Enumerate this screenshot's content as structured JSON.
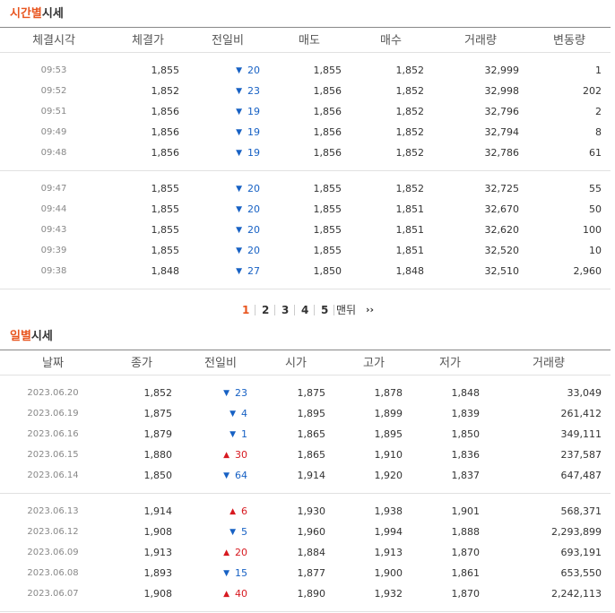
{
  "intraday": {
    "title_accent": "시간별",
    "title_rest": "시세",
    "headers": [
      "체결시각",
      "체결가",
      "전일비",
      "매도",
      "매수",
      "거래량",
      "변동량"
    ],
    "rows": [
      {
        "time": "09:53",
        "price": "1,855",
        "dir": "down",
        "change": "20",
        "ask": "1,855",
        "bid": "1,852",
        "volume": "32,999",
        "delta": "1"
      },
      {
        "time": "09:52",
        "price": "1,852",
        "dir": "down",
        "change": "23",
        "ask": "1,856",
        "bid": "1,852",
        "volume": "32,998",
        "delta": "202"
      },
      {
        "time": "09:51",
        "price": "1,856",
        "dir": "down",
        "change": "19",
        "ask": "1,856",
        "bid": "1,852",
        "volume": "32,796",
        "delta": "2"
      },
      {
        "time": "09:49",
        "price": "1,856",
        "dir": "down",
        "change": "19",
        "ask": "1,856",
        "bid": "1,852",
        "volume": "32,794",
        "delta": "8"
      },
      {
        "time": "09:48",
        "price": "1,856",
        "dir": "down",
        "change": "19",
        "ask": "1,856",
        "bid": "1,852",
        "volume": "32,786",
        "delta": "61"
      },
      {
        "time": "09:47",
        "price": "1,855",
        "dir": "down",
        "change": "20",
        "ask": "1,855",
        "bid": "1,852",
        "volume": "32,725",
        "delta": "55"
      },
      {
        "time": "09:44",
        "price": "1,855",
        "dir": "down",
        "change": "20",
        "ask": "1,855",
        "bid": "1,851",
        "volume": "32,670",
        "delta": "50"
      },
      {
        "time": "09:43",
        "price": "1,855",
        "dir": "down",
        "change": "20",
        "ask": "1,855",
        "bid": "1,851",
        "volume": "32,620",
        "delta": "100"
      },
      {
        "time": "09:39",
        "price": "1,855",
        "dir": "down",
        "change": "20",
        "ask": "1,855",
        "bid": "1,851",
        "volume": "32,520",
        "delta": "10"
      },
      {
        "time": "09:38",
        "price": "1,848",
        "dir": "down",
        "change": "27",
        "ask": "1,850",
        "bid": "1,848",
        "volume": "32,510",
        "delta": "2,960"
      }
    ]
  },
  "pagination": {
    "pages": [
      "1",
      "2",
      "3",
      "4",
      "5"
    ],
    "active": "1",
    "last_label": "맨뒤",
    "next_icon": "double-chevron-right-icon",
    "next_glyph": "››"
  },
  "daily": {
    "title_accent": "일별",
    "title_rest": "시세",
    "headers": [
      "날짜",
      "종가",
      "전일비",
      "시가",
      "고가",
      "저가",
      "거래량"
    ],
    "rows": [
      {
        "date": "2023.06.20",
        "close": "1,852",
        "dir": "down",
        "change": "23",
        "open": "1,875",
        "high": "1,878",
        "low": "1,848",
        "volume": "33,049"
      },
      {
        "date": "2023.06.19",
        "close": "1,875",
        "dir": "down",
        "change": "4",
        "open": "1,895",
        "high": "1,899",
        "low": "1,839",
        "volume": "261,412"
      },
      {
        "date": "2023.06.16",
        "close": "1,879",
        "dir": "down",
        "change": "1",
        "open": "1,865",
        "high": "1,895",
        "low": "1,850",
        "volume": "349,111"
      },
      {
        "date": "2023.06.15",
        "close": "1,880",
        "dir": "up",
        "change": "30",
        "open": "1,865",
        "high": "1,910",
        "low": "1,836",
        "volume": "237,587"
      },
      {
        "date": "2023.06.14",
        "close": "1,850",
        "dir": "down",
        "change": "64",
        "open": "1,914",
        "high": "1,920",
        "low": "1,837",
        "volume": "647,487"
      },
      {
        "date": "2023.06.13",
        "close": "1,914",
        "dir": "up",
        "change": "6",
        "open": "1,930",
        "high": "1,938",
        "low": "1,901",
        "volume": "568,371"
      },
      {
        "date": "2023.06.12",
        "close": "1,908",
        "dir": "down",
        "change": "5",
        "open": "1,960",
        "high": "1,994",
        "low": "1,888",
        "volume": "2,293,899"
      },
      {
        "date": "2023.06.09",
        "close": "1,913",
        "dir": "up",
        "change": "20",
        "open": "1,884",
        "high": "1,913",
        "low": "1,870",
        "volume": "693,191"
      },
      {
        "date": "2023.06.08",
        "close": "1,893",
        "dir": "down",
        "change": "15",
        "open": "1,877",
        "high": "1,900",
        "low": "1,861",
        "volume": "653,550"
      },
      {
        "date": "2023.06.07",
        "close": "1,908",
        "dir": "up",
        "change": "40",
        "open": "1,890",
        "high": "1,932",
        "low": "1,870",
        "volume": "2,242,113"
      }
    ]
  },
  "colors": {
    "accent": "#e8551f",
    "down": "#1761c4",
    "up": "#d71920"
  },
  "glyphs": {
    "down": "▼",
    "up": "▲"
  }
}
